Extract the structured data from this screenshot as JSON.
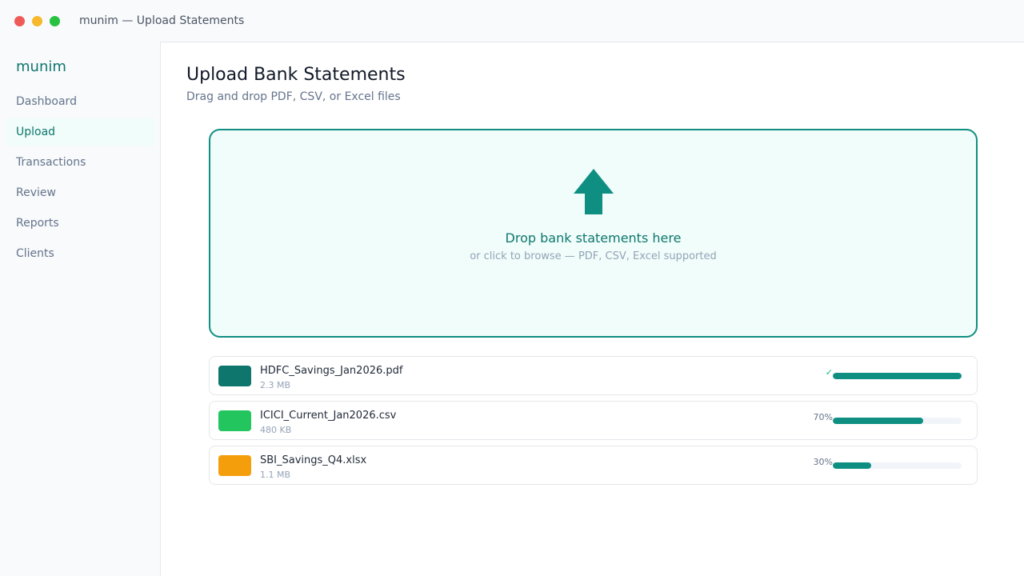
{
  "window": {
    "title": "munim — Upload Statements"
  },
  "sidebar": {
    "brand": "munim",
    "items": [
      {
        "label": "Dashboard"
      },
      {
        "label": "Upload",
        "active": true
      },
      {
        "label": "Transactions"
      },
      {
        "label": "Review"
      },
      {
        "label": "Reports"
      },
      {
        "label": "Clients"
      }
    ]
  },
  "main": {
    "title": "Upload Bank Statements",
    "subtitle": "Drag and drop PDF, CSV, or Excel files",
    "dropzone": {
      "icon": "upload-arrow-icon",
      "title": "Drop bank statements here",
      "subtitle": "or click to browse — PDF, CSV, Excel supported"
    },
    "files": [
      {
        "name": "HDFC_Savings_Jan2026.pdf",
        "size": "2.3 MB",
        "status": "✓",
        "progress": 100,
        "icon_color": "#0f766e"
      },
      {
        "name": "ICICI_Current_Jan2026.csv",
        "size": "480 KB",
        "status": "70%",
        "progress": 70,
        "icon_color": "#22c55e"
      },
      {
        "name": "SBI_Savings_Q4.xlsx",
        "size": "1.1 MB",
        "status": "30%",
        "progress": 30,
        "icon_color": "#f59e0b"
      }
    ]
  },
  "colors": {
    "accent": "#0f8f82",
    "brand": "#0f766e",
    "dropzone_bg": "#f0fdfa"
  }
}
